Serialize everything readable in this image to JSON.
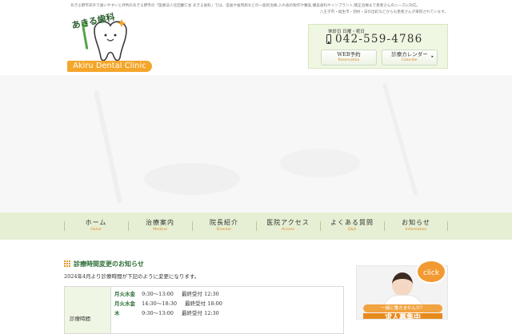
{
  "header": {
    "intro_line1": "あきる野市郊外で通いやすいと評判のあきる野市の「医療法人社団慶仁会 あきる歯科」では、虫歯や歯周病などの一般的治療,入れ歯の製作や審美,審美歯科やインプラント,矯正治療まで患者さんのニーズに対応。",
    "intro_line2": "八王子市・福生市・羽村・日の出町などからも患者さんが来院されています。",
    "logo": {
      "title_ja": "あきる歯科",
      "name_en": "Akiru Dental Clinic"
    }
  },
  "contact": {
    "closed_days": "休診日 日曜・祝日",
    "phone": "042-559-4786",
    "web_reservation": {
      "ja": "WEB予約",
      "en": "Reservation"
    },
    "calendar": {
      "ja": "診療カレンダー",
      "en": "Calendar"
    }
  },
  "nav": [
    {
      "ja": "ホーム",
      "en": "Home"
    },
    {
      "ja": "治療案内",
      "en": "Medical"
    },
    {
      "ja": "院長紹介",
      "en": "Director"
    },
    {
      "ja": "医院アクセス",
      "en": "Access"
    },
    {
      "ja": "よくある質問",
      "en": "Q&A"
    },
    {
      "ja": "お知らせ",
      "en": "Information"
    }
  ],
  "notice": {
    "title": "診療時間変更のお知らせ",
    "text": "2024年4月より診療時間が下記のように変更になります。",
    "table_header": "診療時間",
    "rows": [
      {
        "days": "月火水金",
        "time": "9:30～13:00",
        "last": "最終受付 12:30"
      },
      {
        "days": "月火水金",
        "time": "14:30～18:30",
        "last": "最終受付 18:00"
      },
      {
        "days": "木",
        "time": "9:30～13:00",
        "last": "最終受付 12:30"
      }
    ]
  },
  "recruit": {
    "click": "click",
    "sub": "一緒に働きませんか？",
    "main": "求人募集中"
  },
  "colors": {
    "accent_green": "#2d6e36",
    "nav_bg": "#e6efd4",
    "orange": "#f4a62a"
  }
}
